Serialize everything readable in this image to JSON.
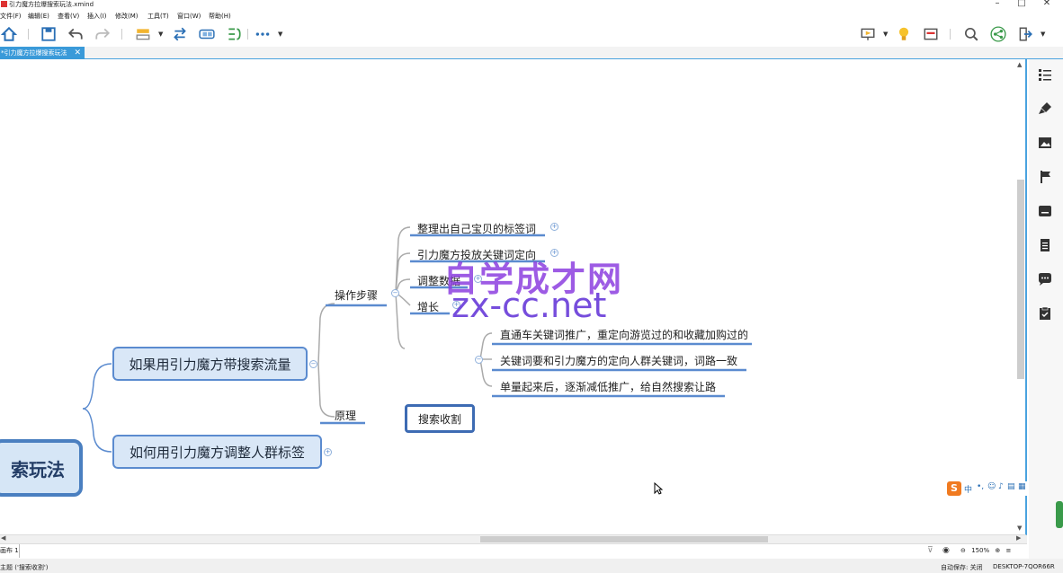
{
  "window": {
    "title": "引力魔方拉爆搜索玩法.xmind",
    "controls": [
      "–",
      "□",
      "✕"
    ]
  },
  "menu": [
    "文件(F)",
    "编辑(E)",
    "查看(V)",
    "插入(I)",
    "修改(M)",
    "工具(T)",
    "窗口(W)",
    "帮助(H)"
  ],
  "toolbar": {
    "icons": [
      "home-icon",
      "save-icon",
      "undo-icon",
      "redo-icon",
      "topic-style-icon",
      "relationship-icon",
      "boundary-icon",
      "summary-icon",
      "more-icon",
      "presentation-icon",
      "idea-icon",
      "panel-icon",
      "search-icon",
      "share-icon",
      "export-icon"
    ]
  },
  "tab": {
    "label": "*引力魔方拉爆搜索玩法",
    "close": "✕"
  },
  "mindmap": {
    "root": "索玩法",
    "main1": "如果用引力魔方带搜索流量",
    "main2": "如何用引力魔方调整人群标签",
    "steps": "操作步骤",
    "principle": "原理",
    "step1": "整理出自己宝贝的标签词",
    "step2": "引力魔方投放关键词定向",
    "step3": "调整数据",
    "step4": "增长",
    "harvest": "搜索收割",
    "harvest1": "直通车关键词推广，重定向游览过的和收藏加购过的",
    "harvest2": "关键词要和引力魔方的定向人群关键词，词路一致",
    "harvest3": "单量起来后，逐渐减低推广，给自然搜索让路"
  },
  "watermark": {
    "line1": "自学成才网",
    "line2": "zx-cc.net"
  },
  "sheet": {
    "name": "画布 1"
  },
  "zoom": {
    "level": "150%",
    "minus": "⊖",
    "plus": "⊕"
  },
  "status": {
    "selection": "主题 ('搜索收割')",
    "autosave": "自动保存: 关闭",
    "computer": "DESKTOP-7QOR66R"
  },
  "ime": {
    "lang": "中",
    "logo": "S"
  },
  "colors": {
    "accent": "#3a9ad9",
    "node_border": "#5b8bcf",
    "node_fill": "#d9e7f7",
    "line": "#5b8bcf"
  }
}
